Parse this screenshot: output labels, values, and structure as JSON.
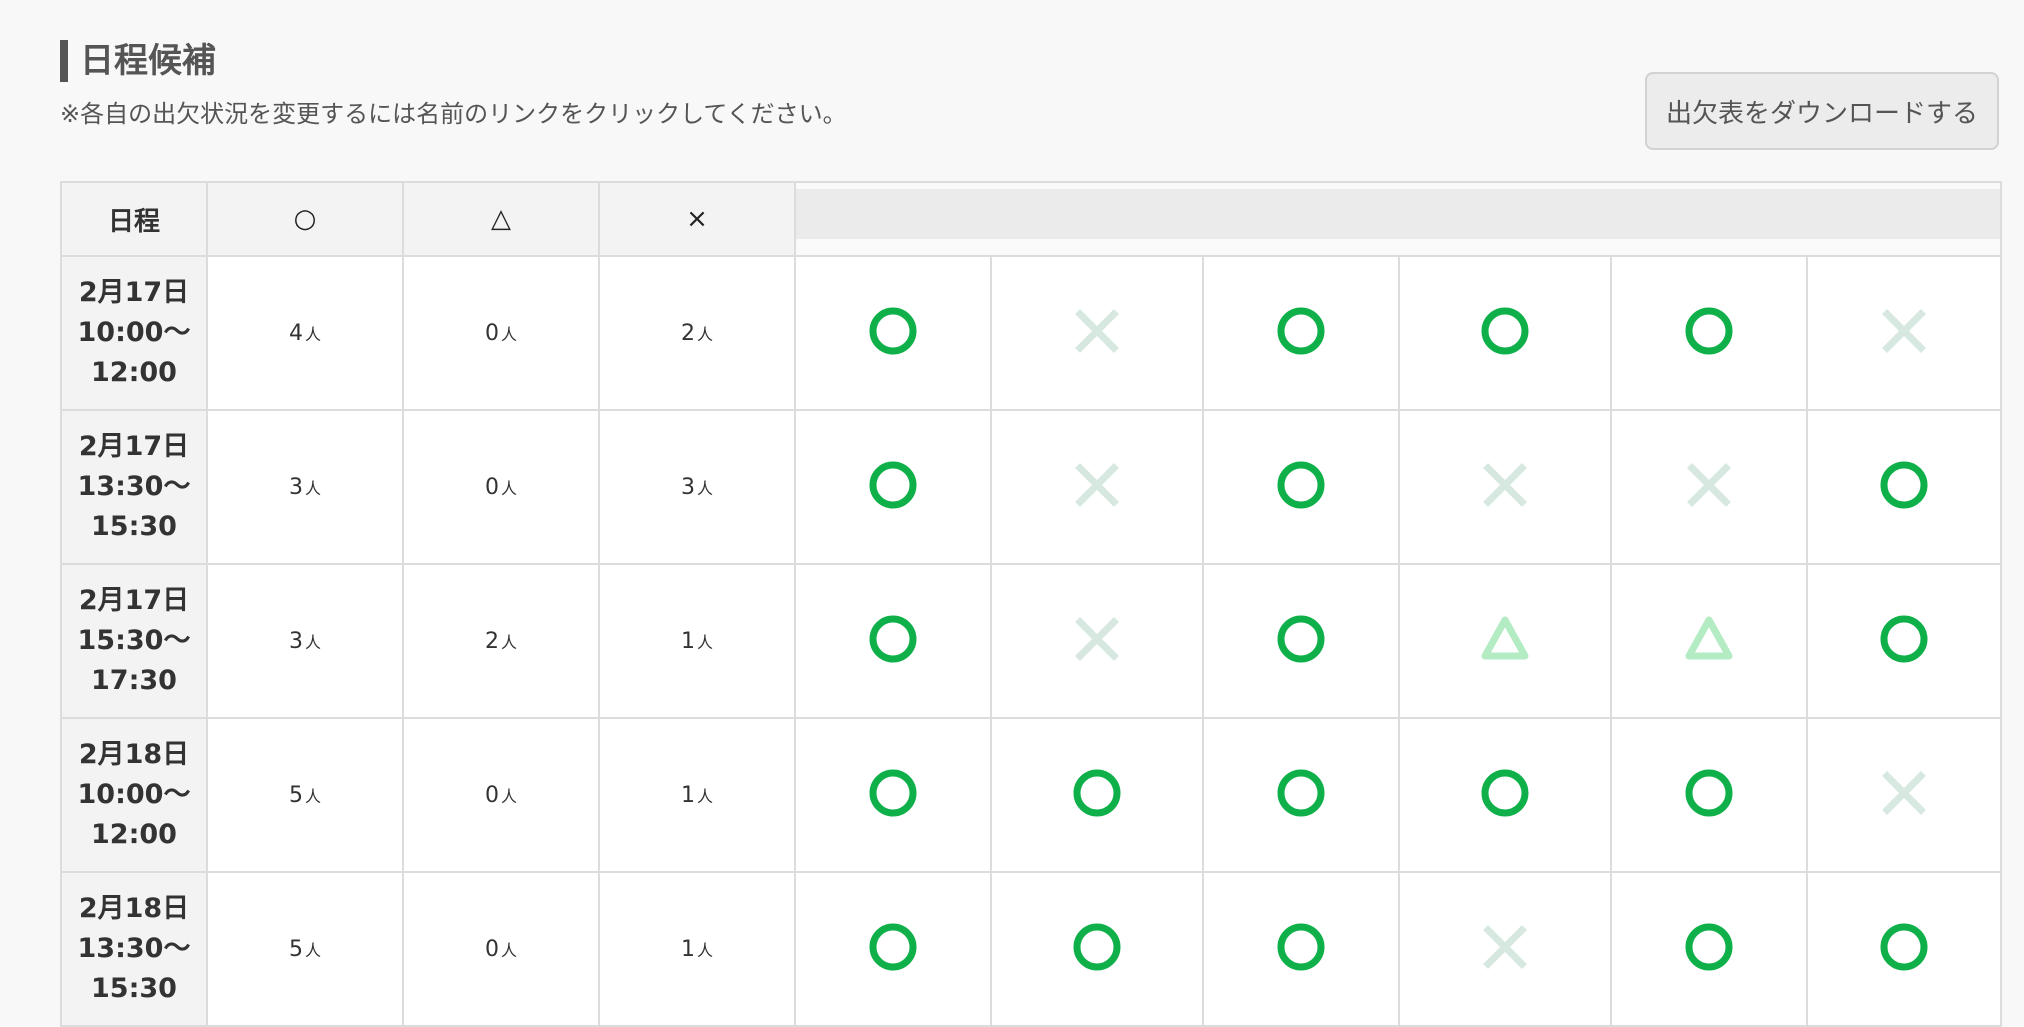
{
  "section": {
    "title": "日程候補",
    "note": "※各自の出欠状況を変更するには名前のリンクをクリックしてください。",
    "download_label": "出欠表をダウンロードする"
  },
  "table": {
    "headers": {
      "date": "日程",
      "yes": "○",
      "maybe": "△",
      "no": "×"
    },
    "unit": "人",
    "member_count": 6,
    "colors": {
      "yes": "#0fb04a",
      "maybe": "#b3ebc3",
      "no": "#d6e8df"
    },
    "rows": [
      {
        "date": [
          "2月17日",
          "10:00〜",
          "12:00"
        ],
        "yes": "4",
        "maybe": "0",
        "no": "2",
        "marks": [
          "yes",
          "no",
          "yes",
          "yes",
          "yes",
          "no"
        ]
      },
      {
        "date": [
          "2月17日",
          "13:30〜",
          "15:30"
        ],
        "yes": "3",
        "maybe": "0",
        "no": "3",
        "marks": [
          "yes",
          "no",
          "yes",
          "no",
          "no",
          "yes"
        ]
      },
      {
        "date": [
          "2月17日",
          "15:30〜",
          "17:30"
        ],
        "yes": "3",
        "maybe": "2",
        "no": "1",
        "marks": [
          "yes",
          "no",
          "yes",
          "maybe",
          "maybe",
          "yes"
        ]
      },
      {
        "date": [
          "2月18日",
          "10:00〜",
          "12:00"
        ],
        "yes": "5",
        "maybe": "0",
        "no": "1",
        "marks": [
          "yes",
          "yes",
          "yes",
          "yes",
          "yes",
          "no"
        ]
      },
      {
        "date": [
          "2月18日",
          "13:30〜",
          "15:30"
        ],
        "yes": "5",
        "maybe": "0",
        "no": "1",
        "marks": [
          "yes",
          "yes",
          "yes",
          "no",
          "yes",
          "yes"
        ]
      }
    ]
  }
}
